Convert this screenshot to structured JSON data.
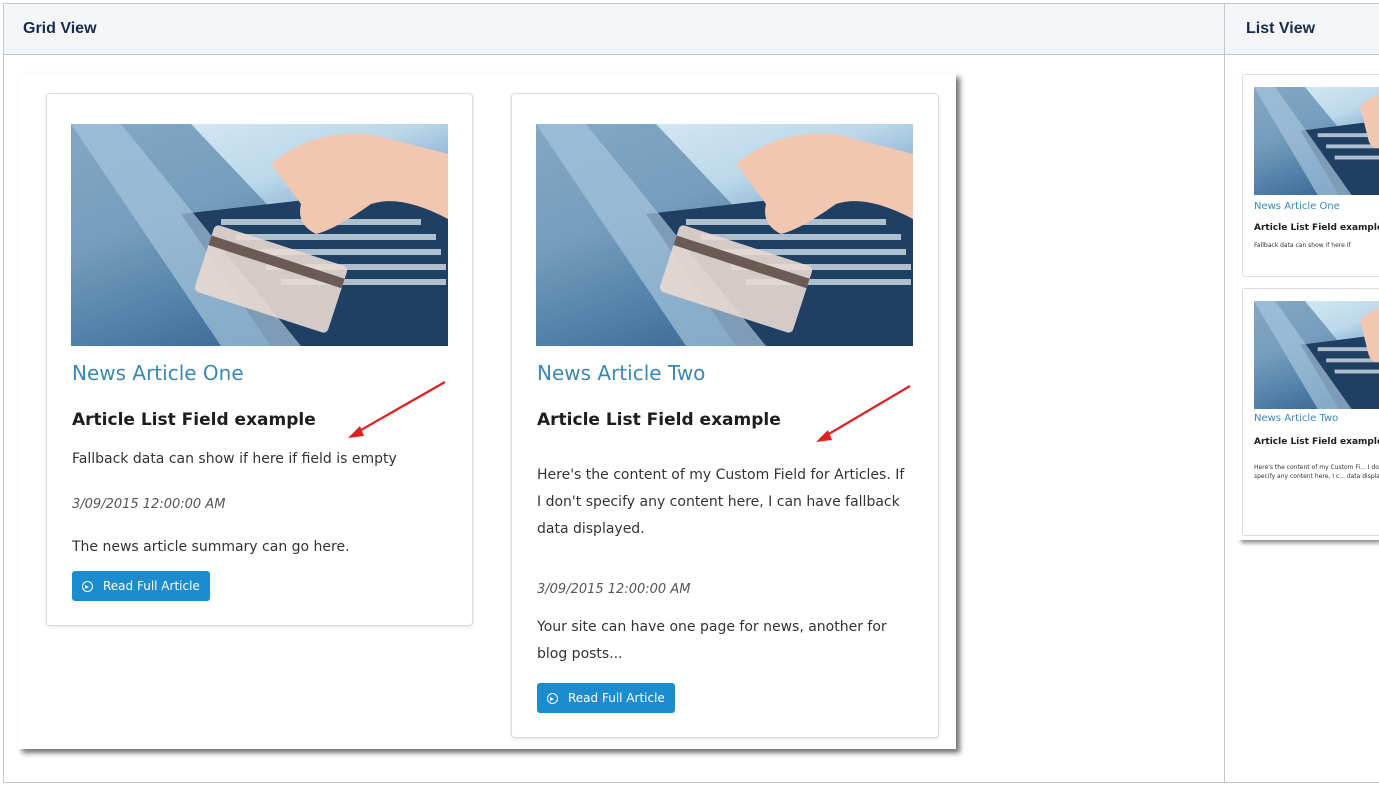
{
  "headers": {
    "grid": "Grid View",
    "list": "List View"
  },
  "grid_cards": [
    {
      "title": "News Article One",
      "field": "Article List Field example",
      "custom_text": "Fallback data can show if here if field is empty",
      "date": "3/09/2015 12:00:00 AM",
      "summary": "The news article summary can go here.",
      "button": "Read Full Article"
    },
    {
      "title": "News Article Two",
      "field": "Article List Field example",
      "custom_text": "Here's the content of my Custom Field for Articles. If I don't specify any content here, I can have fallback data displayed.",
      "date": "3/09/2015 12:00:00 AM",
      "summary": "Your site can have one page for news, another for blog posts...",
      "button": "Read Full Article"
    }
  ],
  "list_items": [
    {
      "title": "News Article One",
      "field": "Article List Field example",
      "custom_text": "Fallback data can show if here if"
    },
    {
      "title": "News Article Two",
      "field": "Article List Field example",
      "custom_text": "Here's the content of my Custom Fi... I don't specify any content here, I c... data displayed."
    }
  ],
  "annotation_color": "#e02020",
  "accent": "#1b8ccd",
  "title_color": "#3a87b7"
}
